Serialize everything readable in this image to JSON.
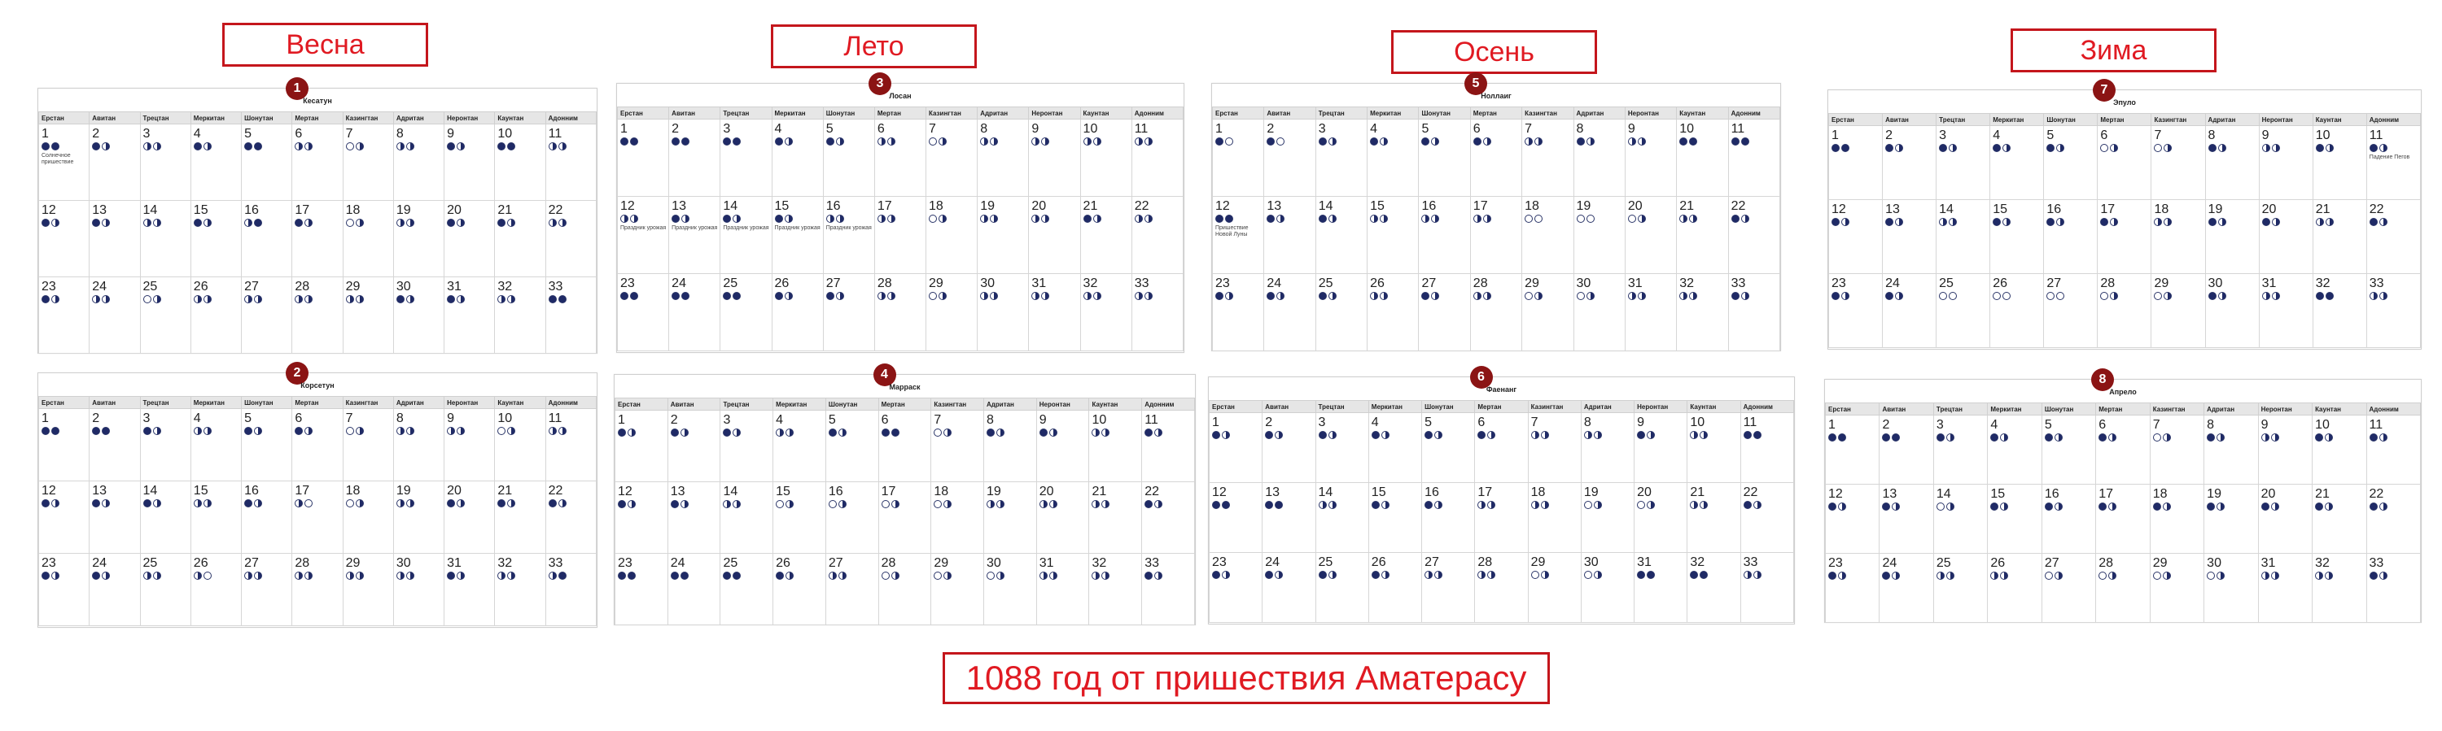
{
  "seasons": [
    "Весна",
    "Лето",
    "Осень",
    "Зима"
  ],
  "footer": "1088 год от пришествия Аматерасу",
  "weekdays": [
    "Ерстан",
    "Авитан",
    "Трецтан",
    "Меркитан",
    "Шонутан",
    "Мертан",
    "Казингтан",
    "Адритан",
    "Неронтан",
    "Каунтан",
    "Адонним"
  ],
  "months": [
    {
      "num": "1",
      "name": "Кесатун",
      "moons": [
        "nn",
        "nw",
        "ww",
        "nw",
        "nn",
        "ww",
        "fw",
        "ww",
        "nw",
        "nn",
        "ww",
        "nw",
        "nw",
        "ww",
        "nw",
        "wn",
        "nw",
        "fw",
        "ww",
        "nw",
        "nw",
        "ww",
        "nw",
        "ww",
        "fw",
        "ww",
        "ww",
        "ww",
        "ww",
        "nw",
        "nw",
        "ww",
        "nn"
      ],
      "notes": {
        "1": "Солнечное пришествие"
      }
    },
    {
      "num": "2",
      "name": "Корсетун",
      "moons": [
        "nn",
        "nn",
        "nw",
        "ww",
        "nw",
        "nw",
        "fw",
        "ww",
        "ww",
        "fw",
        "ww",
        "nw",
        "nw",
        "nw",
        "ww",
        "nw",
        "wf",
        "fw",
        "ww",
        "nw",
        "nw",
        "nw",
        "nw",
        "nw",
        "ww",
        "wf",
        "ww",
        "ww",
        "ww",
        "ww",
        "nw",
        "ww",
        "wn"
      ],
      "notes": {}
    },
    {
      "num": "3",
      "name": "Лосан",
      "moons": [
        "nn",
        "nn",
        "nn",
        "nw",
        "nw",
        "ww",
        "fw",
        "ww",
        "ww",
        "ww",
        "ww",
        "ww",
        "nw",
        "nw",
        "nw",
        "ww",
        "ww",
        "fw",
        "ww",
        "ww",
        "nw",
        "ww",
        "nn",
        "nn",
        "nn",
        "nw",
        "nw",
        "ww",
        "fw",
        "ww",
        "ww",
        "ww",
        "ww"
      ],
      "notes": {
        "12": "Праздник урожая",
        "13": "Праздник урожая",
        "14": "Праздник урожая",
        "15": "Праздник урожая",
        "16": "Праздник урожая"
      }
    },
    {
      "num": "4",
      "name": "Марраск",
      "moons": [
        "nw",
        "nw",
        "nw",
        "ww",
        "nw",
        "nn",
        "fw",
        "nw",
        "nw",
        "ww",
        "nw",
        "nw",
        "nw",
        "ww",
        "fw",
        "fw",
        "fw",
        "fw",
        "ww",
        "ww",
        "ww",
        "nw",
        "nn",
        "nn",
        "nn",
        "nw",
        "ww",
        "fw",
        "fw",
        "fw",
        "ww",
        "ww",
        "nw"
      ],
      "notes": {}
    },
    {
      "num": "5",
      "name": "Ноллаиг",
      "moons": [
        "nf",
        "nf",
        "nw",
        "nw",
        "nw",
        "nw",
        "ww",
        "nw",
        "ww",
        "nn",
        "nn",
        "nn",
        "nw",
        "nw",
        "ww",
        "ww",
        "ww",
        "ff",
        "ff",
        "fw",
        "ww",
        "nw",
        "nw",
        "nw",
        "nw",
        "ww",
        "nw",
        "ww",
        "fw",
        "fw",
        "ww",
        "ww",
        "nw"
      ],
      "notes": {
        "12": "Пришествие Новой Луны"
      }
    },
    {
      "num": "6",
      "name": "Фаенанг",
      "moons": [
        "nw",
        "nw",
        "nw",
        "nw",
        "nw",
        "nw",
        "ww",
        "ww",
        "nw",
        "ww",
        "nn",
        "nn",
        "nn",
        "ww",
        "nw",
        "nw",
        "ww",
        "ww",
        "fw",
        "fw",
        "ww",
        "nw",
        "nw",
        "nw",
        "nw",
        "nw",
        "ww",
        "ww",
        "fw",
        "fw",
        "nn",
        "nn",
        "ww"
      ],
      "notes": {}
    },
    {
      "num": "7",
      "name": "Эпуло",
      "moons": [
        "nn",
        "nw",
        "nw",
        "nw",
        "nw",
        "fw",
        "fw",
        "nw",
        "ww",
        "nw",
        "nw",
        "nw",
        "nw",
        "ww",
        "nw",
        "nw",
        "nw",
        "ww",
        "nw",
        "nw",
        "ww",
        "nw",
        "nw",
        "nw",
        "ff",
        "ff",
        "ff",
        "fw",
        "fw",
        "nw",
        "ww",
        "nn",
        "ww"
      ],
      "notes": {
        "11": "Падение Пегов"
      }
    },
    {
      "num": "8",
      "name": "Апрело",
      "moons": [
        "nn",
        "nn",
        "nw",
        "nw",
        "nw",
        "nw",
        "fw",
        "nw",
        "ww",
        "nw",
        "nw",
        "nw",
        "nw",
        "fw",
        "nw",
        "nw",
        "nw",
        "nw",
        "nw",
        "nw",
        "nw",
        "nw",
        "nw",
        "nw",
        "ww",
        "ww",
        "fw",
        "fw",
        "fw",
        "fw",
        "ww",
        "ww",
        "nw"
      ],
      "notes": {}
    }
  ]
}
